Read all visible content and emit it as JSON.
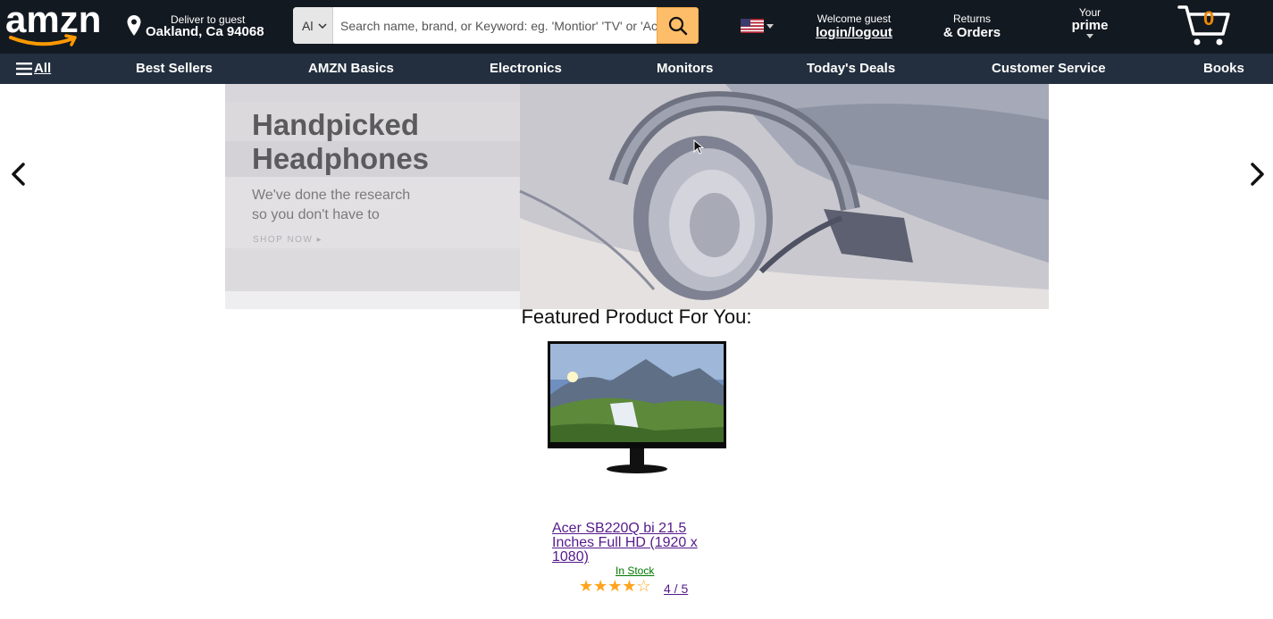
{
  "header": {
    "logo_text": "amzn",
    "deliver_line1": "Deliver to guest",
    "deliver_line2": "Oakland, Ca 94068",
    "search_category": "Al",
    "search_placeholder": "Search name, brand, or Keyword: eg. 'Montior' 'TV' or 'Acer'",
    "account_line1": "Welcome guest",
    "account_line2": "login/logout",
    "orders_line1": "Returns",
    "orders_line2": "& Orders",
    "prime_line1": "Your",
    "prime_line2": "prime",
    "cart_count": "0"
  },
  "subnav": {
    "all_label": "All",
    "items": [
      "Best Sellers",
      "AMZN Basics",
      "Electronics",
      "Monitors",
      "Today's Deals",
      "Customer Service",
      "Books"
    ]
  },
  "hero": {
    "title": "Handpicked\nHeadphones",
    "subtitle": "We've done the research\nso you don't have to",
    "cta": "SHOP NOW ▸"
  },
  "featured": {
    "heading": "Featured Product For You:",
    "product_title": "Acer SB220Q bi 21.5 Inches Full HD (1920 x 1080)",
    "stock": "In Stock",
    "stars": "★★★★☆",
    "rating": " 4 / 5"
  },
  "colors": {
    "topbar": "#131921",
    "subnav": "#232f3e",
    "search_button": "#febd69",
    "cart_count": "#f08804",
    "star": "#ffa41c",
    "link": "#551a8b",
    "in_stock": "#007600"
  },
  "icons": {
    "location": "map-pin-icon",
    "search": "magnifier-icon",
    "flag": "us-flag-icon",
    "cart": "shopping-cart-icon",
    "menu": "hamburger-icon",
    "prev": "chevron-left-icon",
    "next": "chevron-right-icon"
  }
}
